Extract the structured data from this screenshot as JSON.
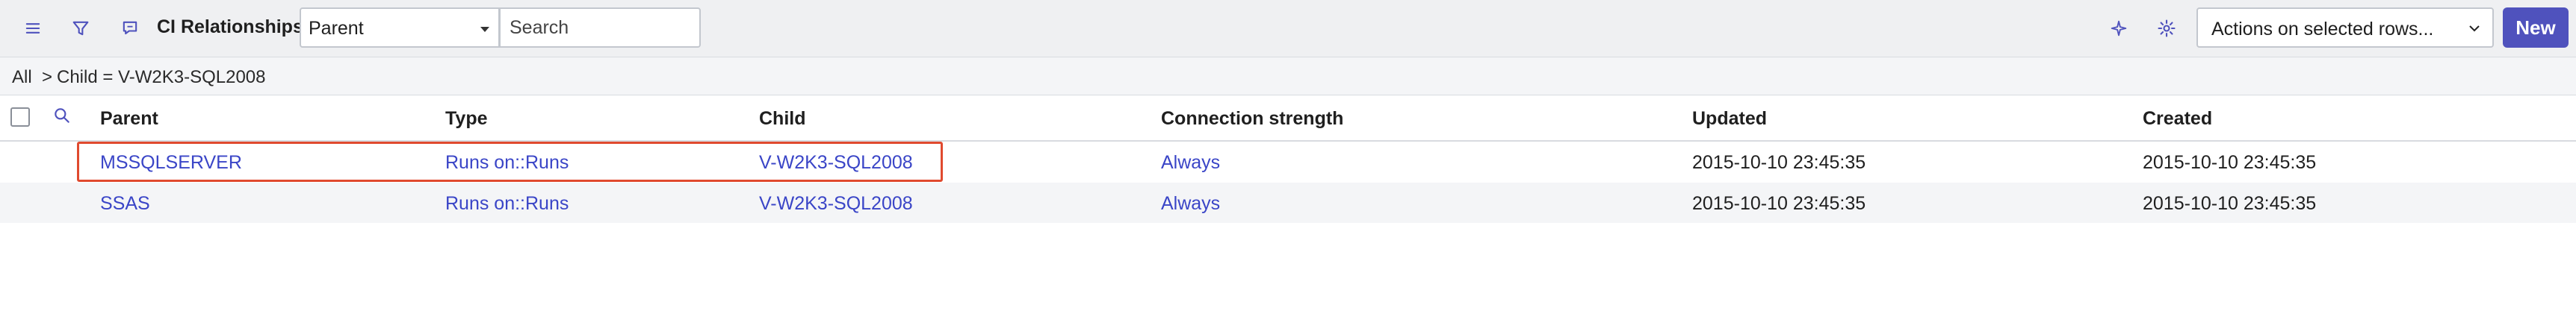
{
  "header": {
    "title": "CI Relationships",
    "filter_field": "Parent",
    "search_placeholder": "Search",
    "actions_label": "Actions on selected rows...",
    "new_label": "New"
  },
  "breadcrumb": {
    "all": "All",
    "sep": ">",
    "condition": "Child = V-W2K3-SQL2008"
  },
  "table": {
    "columns": [
      "Parent",
      "Type",
      "Child",
      "Connection strength",
      "Updated",
      "Created"
    ],
    "rows": [
      {
        "parent": "MSSQLSERVER",
        "type": "Runs on::Runs",
        "child": "V-W2K3-SQL2008",
        "strength": "Always",
        "updated": "2015-10-10 23:45:35",
        "created": "2015-10-10 23:45:35"
      },
      {
        "parent": "SSAS",
        "type": "Runs on::Runs",
        "child": "V-W2K3-SQL2008",
        "strength": "Always",
        "updated": "2015-10-10 23:45:35",
        "created": "2015-10-10 23:45:35"
      }
    ]
  },
  "colors": {
    "accent": "#4f52bd",
    "link": "#3a45c7",
    "highlight": "#e04a2f"
  }
}
